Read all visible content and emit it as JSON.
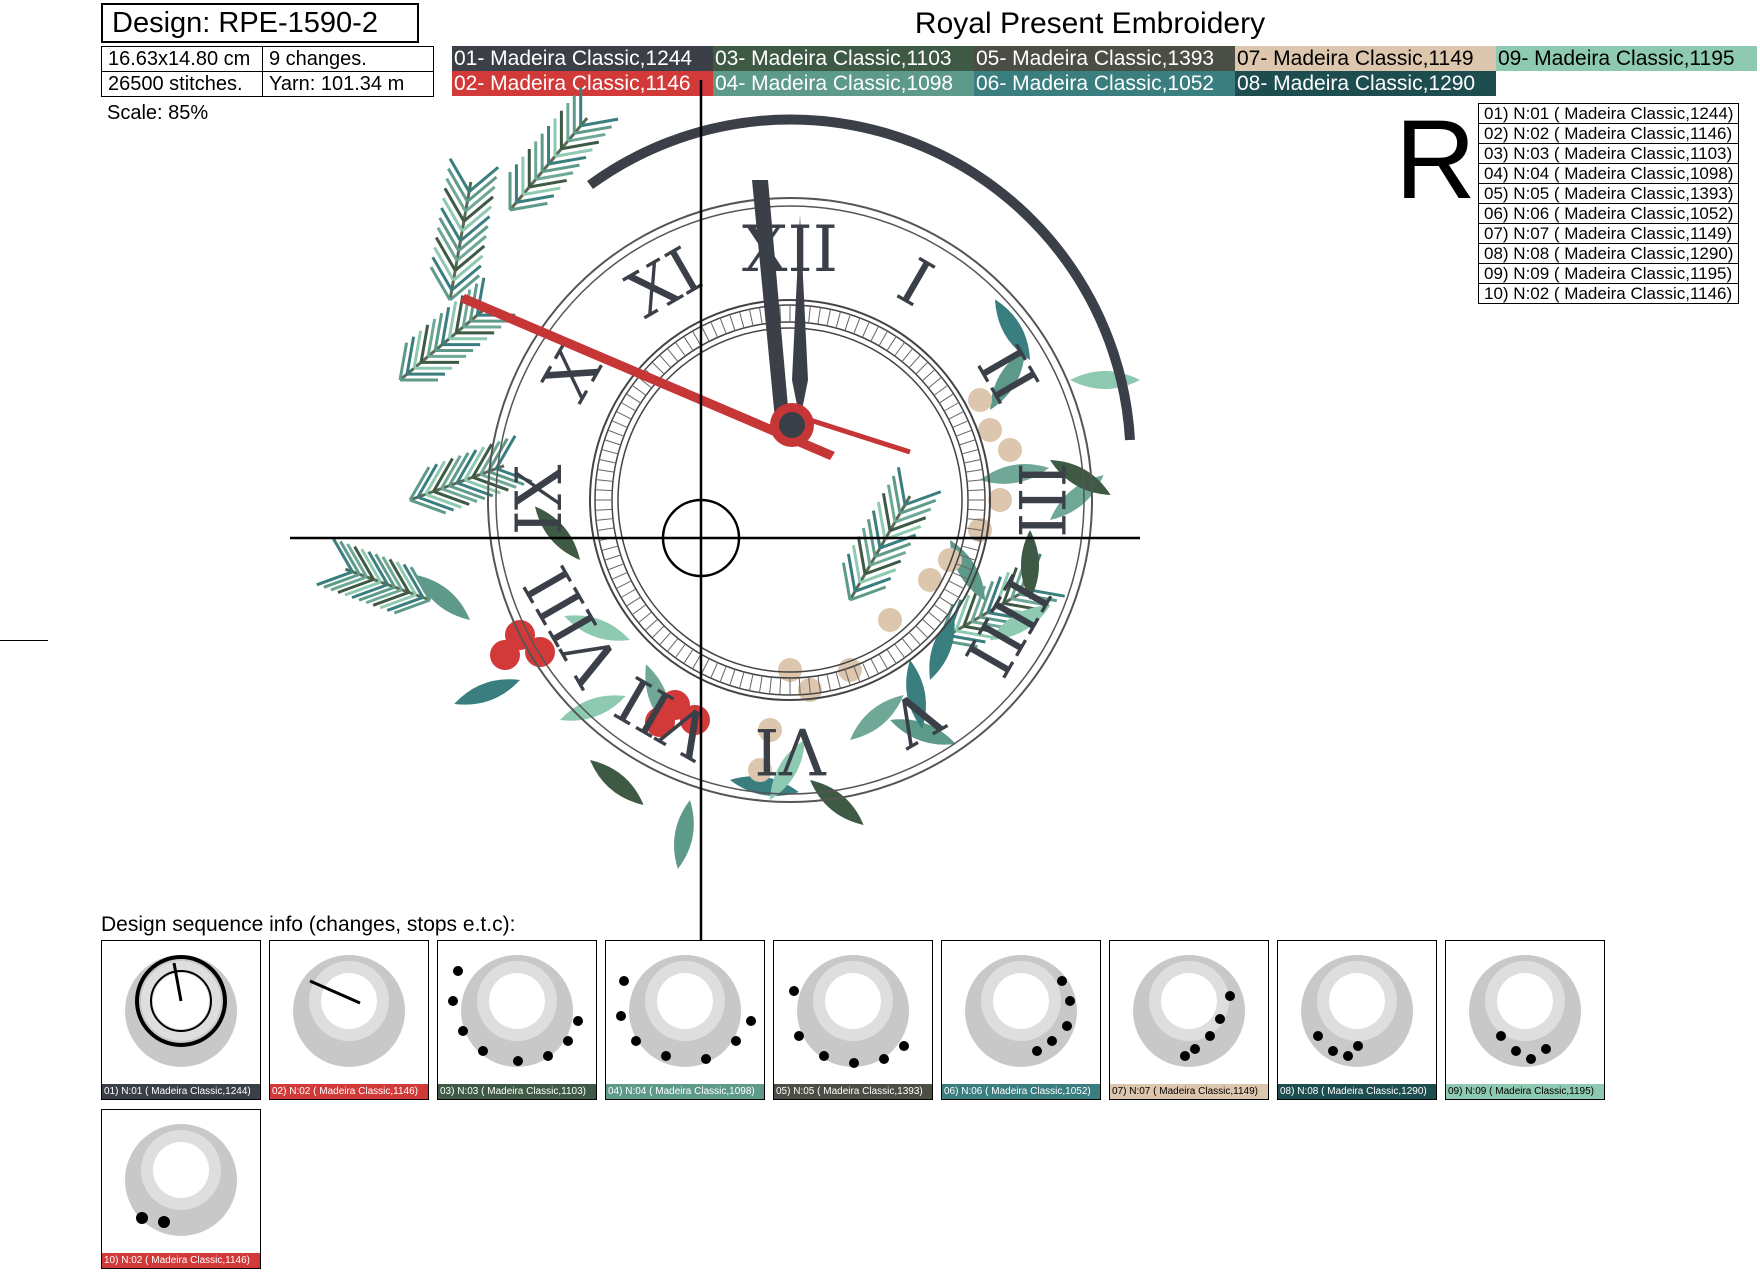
{
  "header": {
    "design_label": "Design: RPE-1590-2",
    "brand": "Royal Present Embroidery",
    "size": "16.63x14.80 cm",
    "changes": "9 changes.",
    "stitches": "26500 stitches.",
    "yarn": "Yarn: 101.34 m",
    "scale": "Scale: 85%"
  },
  "palette": [
    {
      "label": "01- Madeira Classic,1244",
      "color": "#3b3f48",
      "text_color": "#ffffff"
    },
    {
      "label": "02- Madeira Classic,1146",
      "color": "#d23a3a",
      "text_color": "#ffffff"
    },
    {
      "label": "03- Madeira Classic,1103",
      "color": "#3e5a45",
      "text_color": "#ffffff"
    },
    {
      "label": "04- Madeira Classic,1098",
      "color": "#5e9a8a",
      "text_color": "#ffffff"
    },
    {
      "label": "05- Madeira Classic,1393",
      "color": "#4a4e44",
      "text_color": "#ffffff"
    },
    {
      "label": "06- Madeira Classic,1052",
      "color": "#3a7e80",
      "text_color": "#ffffff"
    },
    {
      "label": "07- Madeira Classic,1149",
      "color": "#dcc6ae",
      "text_color": "#000000"
    },
    {
      "label": "08- Madeira Classic,1290",
      "color": "#1e4d4f",
      "text_color": "#ffffff"
    },
    {
      "label": "09- Madeira Classic,1195",
      "color": "#8ec9b1",
      "text_color": "#000000"
    }
  ],
  "logo_letter": "R",
  "sequence_list": [
    "01) N:01 ( Madeira Classic,1244)",
    "02) N:02 ( Madeira Classic,1146)",
    "03) N:03 ( Madeira Classic,1103)",
    "04) N:04 ( Madeira Classic,1098)",
    "05) N:05 ( Madeira Classic,1393)",
    "06) N:06 ( Madeira Classic,1052)",
    "07) N:07 ( Madeira Classic,1149)",
    "08) N:08 ( Madeira Classic,1290)",
    "09) N:09 ( Madeira Classic,1195)",
    "10) N:02 ( Madeira Classic,1146)"
  ],
  "sequence_title": "Design sequence info (changes, stops e.t.c):",
  "thumbnails": [
    {
      "caption": "01) N:01 ( Madeira Classic,1244)",
      "color": "#3b3f48",
      "text_color": "#ffffff",
      "highlight": "clock"
    },
    {
      "caption": "02) N:02 ( Madeira Classic,1146)",
      "color": "#d23a3a",
      "text_color": "#ffffff",
      "highlight": "hand"
    },
    {
      "caption": "03) N:03 ( Madeira Classic,1103)",
      "color": "#3e5a45",
      "text_color": "#ffffff",
      "highlight": "branches"
    },
    {
      "caption": "04) N:04 ( Madeira Classic,1098)",
      "color": "#5e9a8a",
      "text_color": "#ffffff",
      "highlight": "branches2"
    },
    {
      "caption": "05) N:05 ( Madeira Classic,1393)",
      "color": "#4a4e44",
      "text_color": "#ffffff",
      "highlight": "stems"
    },
    {
      "caption": "06) N:06 ( Madeira Classic,1052)",
      "color": "#3a7e80",
      "text_color": "#ffffff",
      "highlight": "leaves-right"
    },
    {
      "caption": "07) N:07 ( Madeira Classic,1149)",
      "color": "#dcc6ae",
      "text_color": "#000000",
      "highlight": "berries"
    },
    {
      "caption": "08) N:08 ( Madeira Classic,1290)",
      "color": "#1e4d4f",
      "text_color": "#ffffff",
      "highlight": "holly"
    },
    {
      "caption": "09) N:09 ( Madeira Classic,1195)",
      "color": "#8ec9b1",
      "text_color": "#000000",
      "highlight": "sprig"
    },
    {
      "caption": "10) N:02 ( Madeira Classic,1146)",
      "color": "#d23a3a",
      "text_color": "#ffffff",
      "highlight": "red-berries"
    }
  ],
  "roman_numerals": [
    "XII",
    "I",
    "II",
    "III",
    "IIII",
    "V",
    "VI",
    "VII",
    "VIII",
    "IX",
    "X",
    "XI"
  ]
}
